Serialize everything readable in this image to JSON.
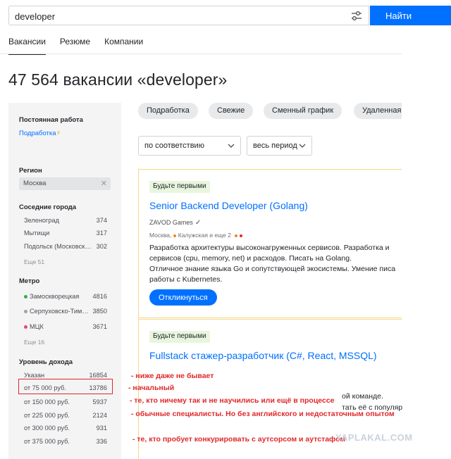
{
  "search": {
    "value": "developer",
    "button_label": "Найти"
  },
  "tabs": [
    {
      "label": "Вакансии",
      "active": true
    },
    {
      "label": "Резюме",
      "active": false
    },
    {
      "label": "Компании",
      "active": false
    }
  ],
  "page_title": "47 564 вакансии «developer»",
  "sidebar": {
    "employment_heading": "Постоянная работа",
    "employment_link": "Подработка",
    "region_heading": "Регион",
    "region_value": "Москва",
    "nearby_heading": "Соседние города",
    "nearby": [
      {
        "label": "Зеленоград",
        "count": "374"
      },
      {
        "label": "Мытищи",
        "count": "317"
      },
      {
        "label": "Подольск (Московская область)",
        "count": "302"
      }
    ],
    "nearby_more": "Еще 51",
    "metro_heading": "Метро",
    "metro": [
      {
        "label": "Замоскворецкая",
        "count": "4816",
        "color": "#2db24a"
      },
      {
        "label": "Серпуховско-Тимирязевская",
        "count": "3850",
        "color": "#a0a2a3"
      },
      {
        "label": "МЦК",
        "count": "3671",
        "color": "#e9457c"
      }
    ],
    "metro_more": "Еще 16",
    "income_heading": "Уровень дохода",
    "income": [
      {
        "label": "Указан",
        "count": "16854"
      },
      {
        "label": "от 75 000 руб.",
        "count": "13786"
      },
      {
        "label": "от 150 000 руб.",
        "count": "5937"
      },
      {
        "label": "от 225 000 руб.",
        "count": "2124"
      },
      {
        "label": "от 300 000 руб.",
        "count": "931"
      },
      {
        "label": "от 375 000 руб.",
        "count": "336"
      }
    ]
  },
  "chips": [
    "Подработка",
    "Свежие",
    "Сменный график",
    "Удаленная работа"
  ],
  "sort": {
    "order": "по соответствию",
    "period": "весь период"
  },
  "vacancies": [
    {
      "badge": "Будьте первыми",
      "title": "Senior Backend Developer (Golang)",
      "company": "ZAVOD Games",
      "location": "Москва,",
      "metro_line": "Калужская и еще 2",
      "desc_lines": [
        "Разработка архитектуры высоконагруженных сервисов. Разработка и",
        "сервисов (cpu, memory, net) и расходов. Писать на Golang.",
        "Отличное знание языка Go и сопутствующей экосистемы. Умение писа",
        "работы с Kubernetes."
      ],
      "apply_label": "Откликнуться"
    },
    {
      "badge": "Будьте первыми",
      "title": "Fullstack стажер-разработчик (C#, React, MSSQL)",
      "fragments": [
        "ой команде.",
        "тать её с популяр"
      ]
    }
  ],
  "annotations": [
    "- ниже даже не бывает",
    "- начальный",
    "- те, кто ничему так и не научились или ещё в процессе",
    "- обычные специалисты.  Но без английского и недостаточным опытом",
    "- те, кто пробует конкурировать с аутсорсом и аутстафом"
  ],
  "watermark": "YAPLAKAL.COM",
  "colors": {
    "accent": "#0070ff",
    "annotation": "#e0282a",
    "badge_bg": "#e8f6de"
  }
}
